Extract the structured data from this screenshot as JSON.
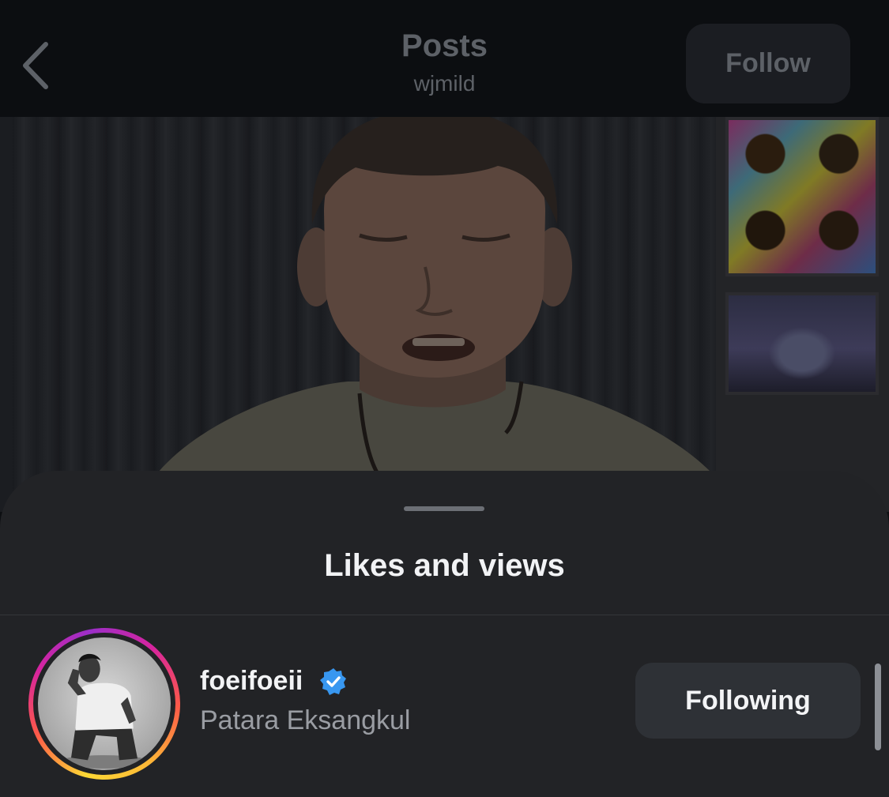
{
  "header": {
    "title": "Posts",
    "subtitle": "wjmild",
    "follow_label": "Follow",
    "back_icon": "chevron-left-icon"
  },
  "media": {
    "description_kind": "video-frame"
  },
  "sheet": {
    "title": "Likes and views",
    "users": [
      {
        "username": "foeifoeii",
        "verified": true,
        "full_name": "Patara Eksangkul",
        "button_label": "Following",
        "story_ring": true
      }
    ]
  },
  "colors": {
    "background": "#0c0e11",
    "sheet": "#222326",
    "button": "#2e3136",
    "verified": "#3897f0",
    "muted_text": "#9a9da3"
  }
}
